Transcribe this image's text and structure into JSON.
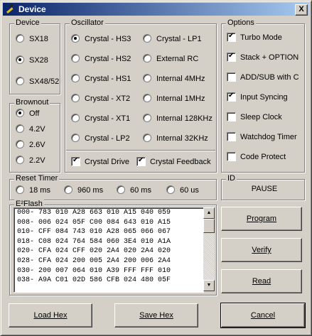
{
  "window": {
    "title": "Device",
    "close": "X"
  },
  "device": {
    "title": "Device",
    "options": [
      {
        "label": "SX18",
        "selected": false
      },
      {
        "label": "SX28",
        "selected": true
      },
      {
        "label": "SX48/52",
        "selected": false
      }
    ]
  },
  "brownout": {
    "title": "Brownout",
    "options": [
      {
        "label": "Off",
        "selected": true
      },
      {
        "label": "4.2V",
        "selected": false
      },
      {
        "label": "2.6V",
        "selected": false
      },
      {
        "label": "2.2V",
        "selected": false
      }
    ]
  },
  "oscillator": {
    "title": "Oscillator",
    "left": [
      {
        "label": "Crystal - HS3",
        "selected": true
      },
      {
        "label": "Crystal - HS2",
        "selected": false
      },
      {
        "label": "Crystal - HS1",
        "selected": false
      },
      {
        "label": "Crystal - XT2",
        "selected": false
      },
      {
        "label": "Crystal - XT1",
        "selected": false
      },
      {
        "label": "Crystal - LP2",
        "selected": false
      }
    ],
    "right": [
      {
        "label": "Crystal - LP1",
        "selected": false
      },
      {
        "label": "External RC",
        "selected": false
      },
      {
        "label": "Internal 4MHz",
        "selected": false
      },
      {
        "label": "Internal 1MHz",
        "selected": false
      },
      {
        "label": "Internal 128KHz",
        "selected": false
      },
      {
        "label": "Internal 32KHz",
        "selected": false
      }
    ],
    "crystal_drive": {
      "label": "Crystal Drive",
      "checked": true
    },
    "crystal_feedback": {
      "label": "Crystal Feedback",
      "checked": true
    }
  },
  "options": {
    "title": "Options",
    "items": [
      {
        "label": "Turbo Mode",
        "checked": true
      },
      {
        "label": "Stack + OPTION",
        "checked": true
      },
      {
        "label": "ADD/SUB with C",
        "checked": false
      },
      {
        "label": "Input Syncing",
        "checked": true
      },
      {
        "label": "Sleep Clock",
        "checked": false
      },
      {
        "label": "Watchdog Timer",
        "checked": false
      },
      {
        "label": "Code Protect",
        "checked": false
      }
    ]
  },
  "reset_timer": {
    "title": "Reset Timer",
    "options": [
      {
        "label": "18 ms",
        "selected": false
      },
      {
        "label": "960 ms",
        "selected": false
      },
      {
        "label": "60 ms",
        "selected": false
      },
      {
        "label": "60 us",
        "selected": false
      }
    ]
  },
  "id": {
    "title": "ID",
    "value": "PAUSE"
  },
  "flash": {
    "title": "E²Flash",
    "rows": [
      "000- 783 010 A28 663 010 A15 040 059",
      "008- 006 024 05F C00 084 643 010 A15",
      "010- CFF 084 743 010 A28 065 066 067",
      "018- C08 024 764 584 060 3E4 010 A1A",
      "020- CFA 024 CFF 020 2A4 020 2A4 020",
      "028- CFA 024 200 005 2A4 200 006 2A4",
      "030- 200 007 064 010 A39 FFF FFF 010",
      "038- A9A C01 02D 586 CFB 024 480 05F"
    ]
  },
  "buttons": {
    "program": "Program",
    "verify": "Verify",
    "read": "Read",
    "load_hex": "Load Hex",
    "save_hex": "Save Hex",
    "cancel": "Cancel"
  }
}
